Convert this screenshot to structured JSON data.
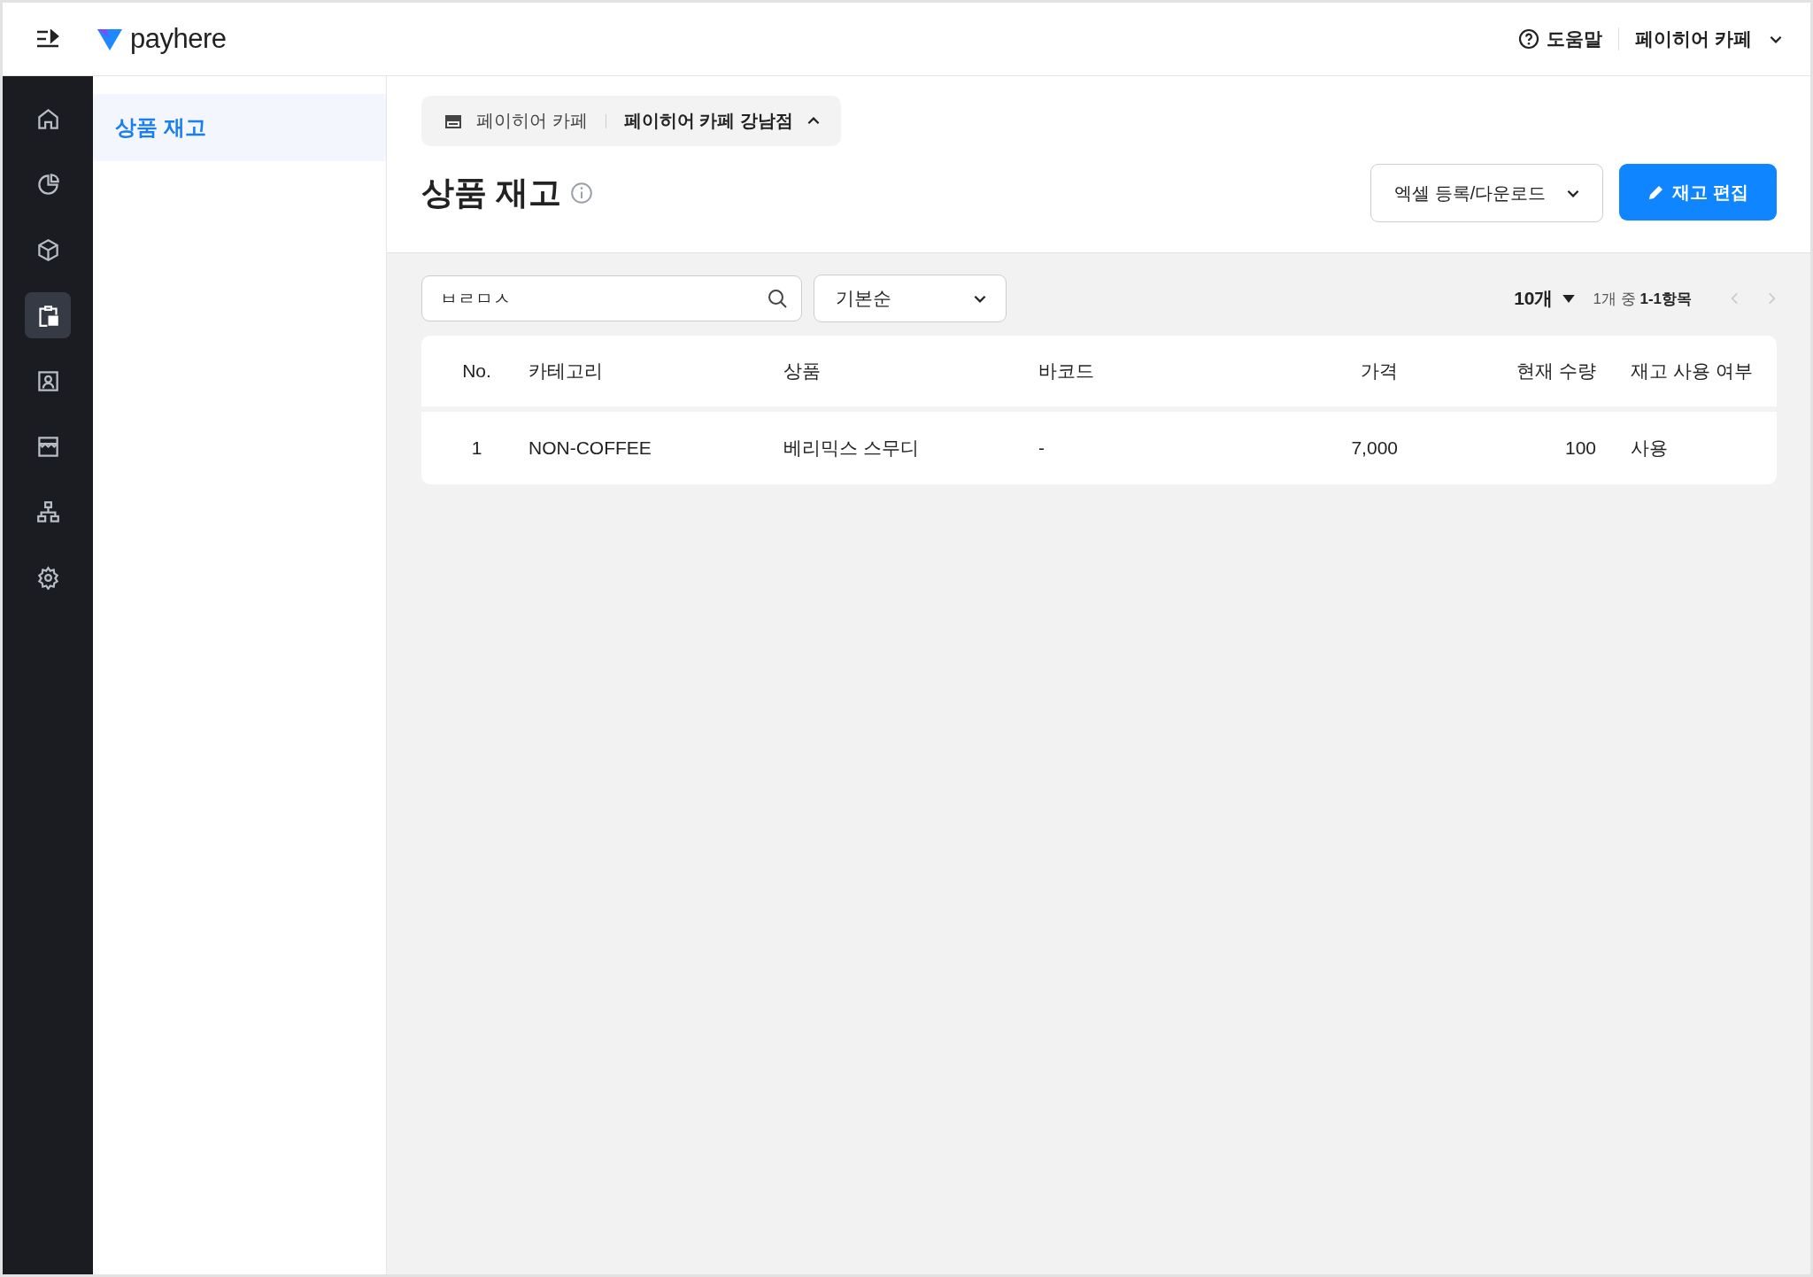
{
  "topbar": {
    "logo": "payhere",
    "help": "도움말",
    "store": "페이히어 카페"
  },
  "nav_rail": [
    {
      "kind": "home",
      "selected": false
    },
    {
      "kind": "chart",
      "selected": false
    },
    {
      "kind": "box",
      "selected": false
    },
    {
      "kind": "clipboard",
      "selected": true
    },
    {
      "kind": "contact",
      "selected": false
    },
    {
      "kind": "store",
      "selected": false
    },
    {
      "kind": "org",
      "selected": false
    },
    {
      "kind": "settings",
      "selected": false
    }
  ],
  "sidebar": {
    "items": [
      {
        "label": "상품 재고",
        "selected": true
      }
    ]
  },
  "breadcrumb": {
    "parent": "페이히어 카페",
    "current": "페이히어 카페 강남점"
  },
  "page_title": "상품 재고",
  "buttons": {
    "excel": "엑셀 등록/다운로드",
    "edit": "재고 편집"
  },
  "search": {
    "value": "ㅂㄹㅁㅅ"
  },
  "sort": {
    "value": "기본순"
  },
  "pagination": {
    "page_size": "10개",
    "range_prefix": "1개 중",
    "range": "1-1항목"
  },
  "table": {
    "columns": [
      "No.",
      "카테고리",
      "상품",
      "바코드",
      "가격",
      "현재 수량",
      "재고 사용 여부"
    ],
    "rows": [
      [
        "1",
        "NON-COFFEE",
        "베리믹스 스무디",
        "-",
        "7,000",
        "100",
        "사용"
      ]
    ]
  }
}
